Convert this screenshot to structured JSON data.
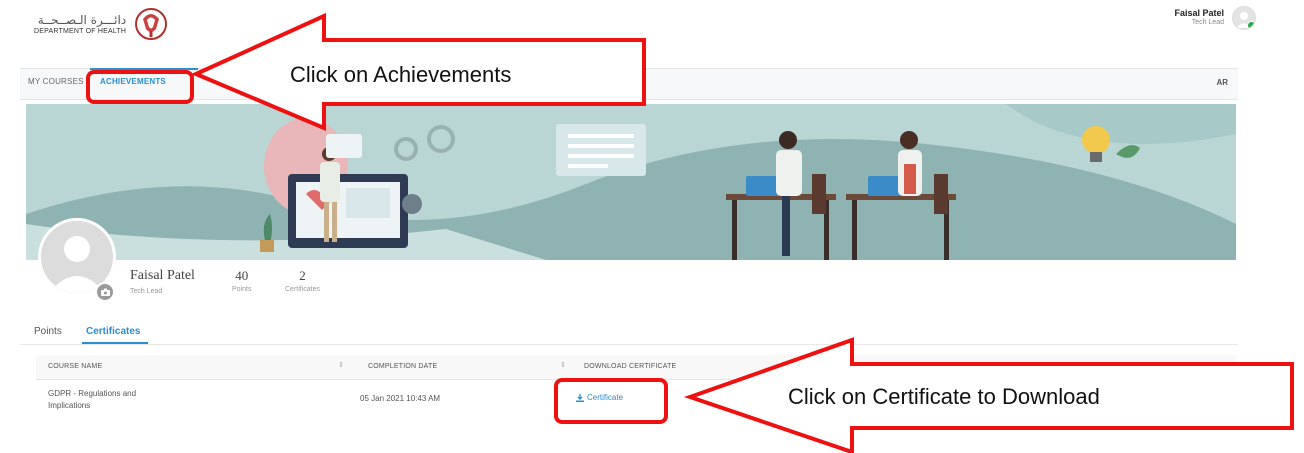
{
  "header": {
    "logo_ar": "دائـــرة الـصــحــة",
    "logo_en": "DEPARTMENT OF HEALTH",
    "user_name": "Faisal Patel",
    "user_role": "Tech Lead"
  },
  "tabs": {
    "courses": "MY COURSES",
    "achievements": "ACHIEVEMENTS",
    "language": "AR"
  },
  "profile": {
    "name": "Faisal Patel",
    "role": "Tech Lead",
    "points_value": "40",
    "points_label": "Points",
    "certs_value": "2",
    "certs_label": "Certificates"
  },
  "subtabs": {
    "points": "Points",
    "certificates": "Certificates"
  },
  "table": {
    "headers": [
      "COURSE NAME",
      "COMPLETION DATE",
      "DOWNLOAD CERTIFICATE"
    ],
    "rows": [
      {
        "course_line1": "GDPR - Regulations and",
        "course_line2": "Implications",
        "date": "05 Jan 2021 10:43 AM",
        "action": "Certificate"
      }
    ]
  },
  "annotations": {
    "achievements_callout": "Click on Achievements",
    "certificate_callout": "Click on Certificate to Download"
  },
  "colors": {
    "accent": "#2b8ecf",
    "annotation_red": "#ee1111",
    "banner_bg": "#b9d6d4",
    "banner_wave": "#8fb3b3"
  },
  "icons": [
    "abu-dhabi-emblem-icon",
    "user-avatar-icon",
    "camera-icon",
    "download-icon",
    "sort-icon"
  ]
}
